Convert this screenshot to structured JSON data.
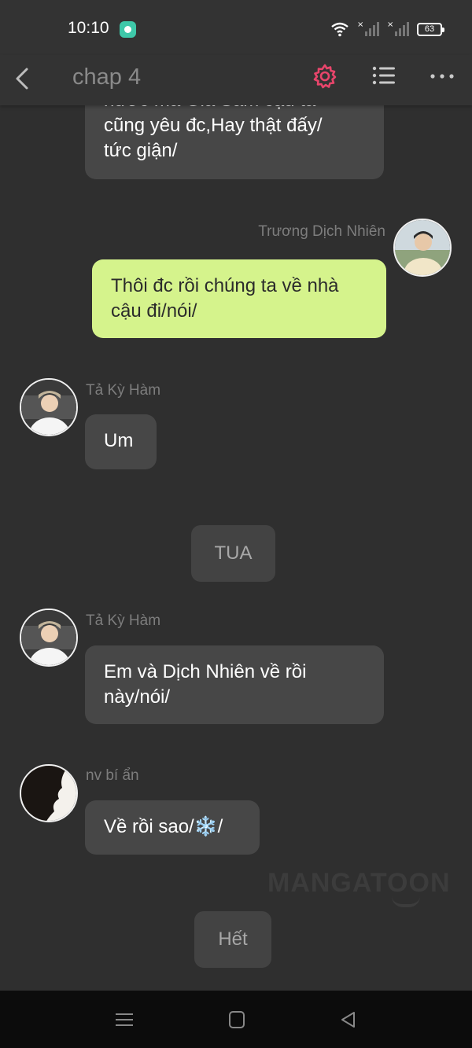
{
  "status_bar": {
    "time": "10:10",
    "battery": "63"
  },
  "header": {
    "title": "chap 4"
  },
  "colors": {
    "accent_gear": "#e8456b",
    "user_bubble": "#d5f38c",
    "bubble": "#474747",
    "background": "#2f2f2f"
  },
  "messages": [
    {
      "type": "left",
      "sender": "",
      "text_lines": [
        "nước mà Gia Sâm cậu ta",
        "cũng yêu đc,Hay thật đấy/",
        "tức giận/"
      ]
    },
    {
      "type": "right",
      "sender": "Trương Dịch Nhiên",
      "text_lines": [
        "Thôi đc rồi chúng ta về nhà",
        "cậu đi/nói/"
      ]
    },
    {
      "type": "left",
      "sender": "Tả Kỳ Hàm",
      "text_lines": [
        "Um"
      ]
    },
    {
      "type": "narration",
      "text": "TUA"
    },
    {
      "type": "left",
      "sender": "Tả Kỳ Hàm",
      "text_lines": [
        "Em và Dịch Nhiên về rồi",
        "này/nói/"
      ]
    },
    {
      "type": "left",
      "sender": "nv bí ẩn",
      "text_lines": [
        "Về rồi sao/❄️/"
      ]
    },
    {
      "type": "narration",
      "text": "Hết"
    }
  ],
  "watermark": "MANGATOON",
  "icons": [
    "back-icon",
    "gear-icon",
    "list-icon",
    "more-icon",
    "wifi-icon",
    "signal-icon",
    "battery-icon",
    "menu-icon",
    "home-icon",
    "back-triangle-icon"
  ]
}
